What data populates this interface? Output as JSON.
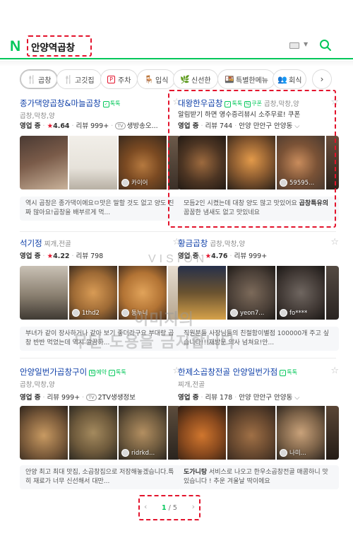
{
  "header": {
    "logo": "N",
    "query": "안양역곱창"
  },
  "chips": [
    {
      "label": "곱창",
      "icon": "fork-knife-icon",
      "glyph": "🍴",
      "active": true
    },
    {
      "label": "고깃집",
      "icon": "fork-knife-icon",
      "glyph": "🍴",
      "active": false
    },
    {
      "label": "주차",
      "icon": "parking-icon",
      "glyph": "P",
      "active": false
    },
    {
      "label": "입식",
      "icon": "chair-icon",
      "glyph": "🪑",
      "active": false
    },
    {
      "label": "신선한",
      "icon": "leaf-icon",
      "glyph": "🌿",
      "active": false
    },
    {
      "label": "특별한메뉴",
      "icon": "dish-icon",
      "glyph": "🍱",
      "active": false
    },
    {
      "label": "회식",
      "icon": "people-icon",
      "glyph": "👥",
      "active": false
    }
  ],
  "places": [
    {
      "name": "종가댁양곱창&마늘곱창",
      "badge": "톡톡",
      "category": "곱창,막창,양",
      "status": "영업 중",
      "rating": "4.64",
      "reviews": "리뷰 999+",
      "tv": "TV",
      "tv_text": "생방송오...",
      "photo_tags": [
        "",
        "",
        "카이어"
      ],
      "review": "역시 곱창은 종가댁이에요ㅁ맛은 말할 것도 없고 양도 진짜 많아요!곱창을 배부르게 먹..."
    },
    {
      "name": "대왕한우곱창",
      "badge": "톡톡",
      "coupon": "쿠폰",
      "category": "곱창,막창,양",
      "promo": "알림받기 하면 영수증리뷰시 소주무료! 쿠폰",
      "status": "영업 중",
      "reviews": "리뷰 744",
      "location": "안양 만안구 안양동",
      "photo_tags": [
        "",
        "",
        "59595..."
      ],
      "review_pre": "모듬2인 시켰는데 대창 양도 많고 맛있어요 ",
      "review_bold": "곱창특유의",
      "review_post": " 꿉꿉한 냄새도 없고 맛있네요"
    },
    {
      "name": "석기정",
      "category": "찌개,전골",
      "status": "영업 중",
      "rating": "4.22",
      "reviews": "리뷰 798",
      "photo_tags": [
        "1thd2",
        "둥누니",
        ""
      ],
      "review": "부녀가 같이 장사하거나 같아 보기 좋더라구요 부대랑 곱창 반반 먹었는데 역시 깔끔하..."
    },
    {
      "name": "황금곱창",
      "category": "곱창,막창,양",
      "status": "영업 중",
      "rating": "4.76",
      "reviews": "리뷰 999+",
      "photo_tags": [
        "",
        "yeon7...",
        "fo****"
      ],
      "review": "직원분들 사장님들의 친절함이별점 100000개 주고 싶습니다!!!재방문 의사 넘쳐요!안..."
    },
    {
      "name": "안양일번가곱창구이",
      "badge": "톡톡",
      "reserve": "예약",
      "category": "곱창,막창,양",
      "status": "영업 중",
      "reviews": "리뷰 999+",
      "tv": "TV",
      "tv_text": "2TV생생정보",
      "photo_tags": [
        "",
        "",
        "ridrkd..."
      ],
      "review": "안양 최고 최대 맛집, 소곱창집으로 저장해놓겠습니다.특히 재료가 너무 신선해서 대만..."
    },
    {
      "name": "한제소곱창전골 안양일번가점",
      "badge": "톡톡",
      "category": "찌개,전골",
      "status": "영업 중",
      "reviews": "리뷰 178",
      "location": "안양 만안구 안양동",
      "photo_tags": [
        "",
        "",
        "나미..."
      ],
      "review_bold": "도가니탕",
      "review_post": " 서비스로 나오고 한우소곱창전골 매콤하니 맛있습니다 ! 추운 겨울날 딱이에요"
    }
  ],
  "watermark": {
    "line1": "이미지의",
    "line2": "무단 도용을 금지합니다",
    "vision": "VISION"
  },
  "pagination": {
    "current": "1",
    "total": "/ 5",
    "prev": "‹",
    "next": "›"
  },
  "colors": {
    "brand": "#03c75a",
    "link": "#0e3fa8",
    "star": "#e3132c",
    "annotation": "#e3132c"
  }
}
